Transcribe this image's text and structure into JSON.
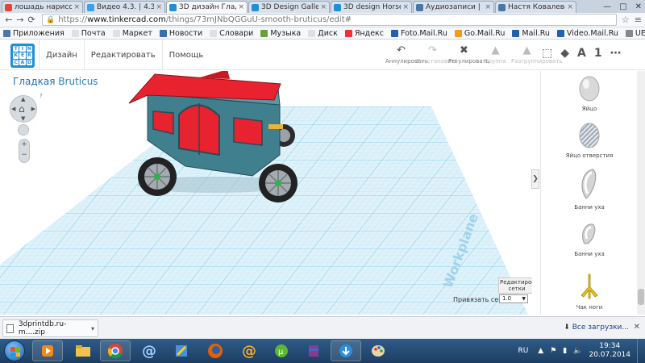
{
  "browser": {
    "tabs": [
      {
        "label": "лошадь нарисов",
        "color": "#e8423b",
        "active": false
      },
      {
        "label": "Видео 4.3. | 4.3.3",
        "color": "#3aa0e8",
        "active": false
      },
      {
        "label": "3D дизайн Гладк",
        "color": "#1f8fd6",
        "active": true
      },
      {
        "label": "3D Design Gallery",
        "color": "#1f8fd6",
        "active": false
      },
      {
        "label": "3D design Horse |",
        "color": "#1f8fd6",
        "active": false
      },
      {
        "label": "Аудиозаписи |",
        "color": "#4a76a8",
        "active": false
      },
      {
        "label": "Настя Ковалева",
        "color": "#4a76a8",
        "active": false
      }
    ],
    "tab_close": "×",
    "window_controls": {
      "minimize": "—",
      "maximize": "□",
      "close": "✕"
    },
    "url_scheme": "https://",
    "url_host": "www.tinkercad.com",
    "url_path": "/things/73mJNbQGGuU-smooth-bruticus/edit#",
    "bookmarks": [
      {
        "label": "Приложения",
        "color": "#4a76a8"
      },
      {
        "label": "Почта",
        "color": "#e0e0e0"
      },
      {
        "label": "Маркет",
        "color": "#e0e0e0"
      },
      {
        "label": "Новости",
        "color": "#3b6db3"
      },
      {
        "label": "Словари",
        "color": "#e0e0e0"
      },
      {
        "label": "Музыка",
        "color": "#6b9f3a"
      },
      {
        "label": "Диск",
        "color": "#e0e0e0"
      },
      {
        "label": "Яндекс",
        "color": "#e33"
      },
      {
        "label": "Foto.Mail.Ru",
        "color": "#2361b0"
      },
      {
        "label": "Go.Mail.Ru",
        "color": "#f29b1f"
      },
      {
        "label": "Mail.Ru",
        "color": "#2361b0"
      },
      {
        "label": "Video.Mail.Ru",
        "color": "#2361b0"
      },
      {
        "label": "UEFA EURO - T...",
        "color": "#888"
      }
    ]
  },
  "app": {
    "logo_letters": [
      "T",
      "I",
      "N",
      "K",
      "E",
      "R",
      "C",
      "A",
      "D"
    ],
    "menu": [
      "Дизайн",
      "Редактировать",
      "Помощь"
    ],
    "tools": [
      {
        "icon": "↶",
        "label": "Аннулировать",
        "dim": false
      },
      {
        "icon": "↷",
        "label": "Восстановить",
        "dim": true
      },
      {
        "icon": "✖",
        "label": "Регулировать",
        "dim": false
      },
      {
        "icon": "▲",
        "label": "Группа",
        "dim": true
      },
      {
        "icon": "▲",
        "label": "Разгруппировать",
        "dim": true
      }
    ],
    "view_tools": {
      "view_cube": "⬚",
      "box": "◆",
      "text": "A",
      "number": "1",
      "more": "⋯"
    },
    "doc_title_first": "Гладкая",
    "doc_title_second": "Bruticus",
    "help": "?",
    "workplane_watermark": "Workplane",
    "edit_grid_label": "Редактировать сетки",
    "snap_label": "Привязать сетки",
    "snap_value": "1.0",
    "collapse": "❯",
    "shapes": [
      {
        "label": "Яйцо",
        "kind": "egg"
      },
      {
        "label": "Яйцо отверстия",
        "kind": "egg-hole"
      },
      {
        "label": "Банни уха",
        "kind": "ear"
      },
      {
        "label": "Банни уха",
        "kind": "ear-small"
      },
      {
        "label": "Чак ноги",
        "kind": "foot"
      }
    ],
    "colors": {
      "body": "#3f7f8e",
      "roof": "#e8232f",
      "accent": "#1f8fd6",
      "wheel_hub": "#2db34a"
    }
  },
  "downloads": {
    "file": "3dprintdb.ru-m....zip",
    "caret": "▾",
    "all_label": "Все загрузки...",
    "close": "✕"
  },
  "taskbar": {
    "lang": "RU",
    "time": "19:34",
    "date": "20.07.2014"
  }
}
